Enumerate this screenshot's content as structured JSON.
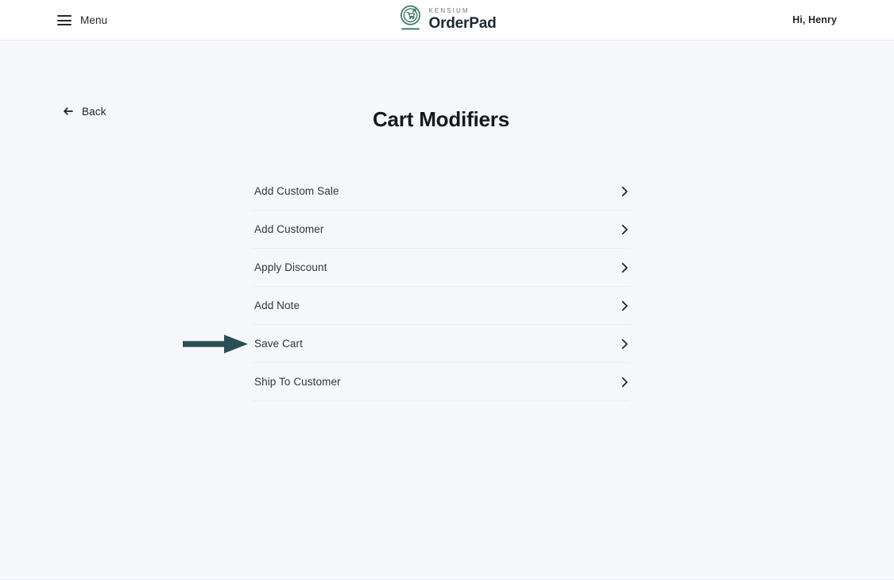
{
  "header": {
    "menu_label": "Menu",
    "menu_icon": "hamburger-icon",
    "brand": {
      "eyebrow": "KENSIUM",
      "name": "OrderPad",
      "logo_icon": "orderpad-cart-circle-logo"
    },
    "greeting": "Hi, Henry"
  },
  "page": {
    "back_label": "Back",
    "back_icon": "arrow-left-icon",
    "title": "Cart Modifiers"
  },
  "modifiers": {
    "items": [
      {
        "label": "Add Custom Sale",
        "chevron_icon": "chevron-right-icon"
      },
      {
        "label": "Add Customer",
        "chevron_icon": "chevron-right-icon"
      },
      {
        "label": "Apply Discount",
        "chevron_icon": "chevron-right-icon"
      },
      {
        "label": "Add Note",
        "chevron_icon": "chevron-right-icon"
      },
      {
        "label": "Save Cart",
        "chevron_icon": "chevron-right-icon"
      },
      {
        "label": "Ship To Customer",
        "chevron_icon": "chevron-right-icon"
      }
    ]
  },
  "annotation": {
    "icon": "pointer-arrow-right-icon",
    "target": "Save Cart",
    "color": "#2a5055"
  },
  "colors": {
    "page_background": "#f6f7fb",
    "header_background": "#ffffff",
    "divider": "#ebedf3",
    "text_primary": "#151820",
    "text_secondary": "#30343c",
    "brand_green": "#3e7c68",
    "annotation_arrow": "#2a5055"
  }
}
